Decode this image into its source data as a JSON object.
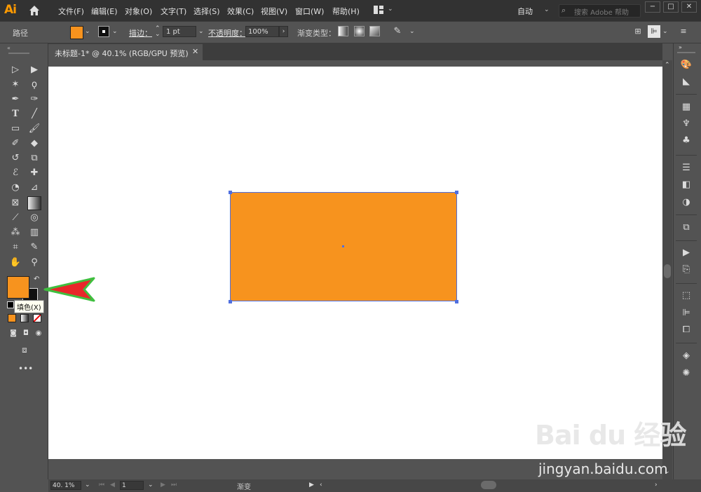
{
  "app": {
    "logo": "Ai"
  },
  "menu": [
    "文件(F)",
    "编辑(E)",
    "对象(O)",
    "文字(T)",
    "选择(S)",
    "效果(C)",
    "视图(V)",
    "窗口(W)",
    "帮助(H)"
  ],
  "workspace": "自动",
  "search": {
    "placeholder": "搜索 Adobe 帮助"
  },
  "window_buttons": [
    "−",
    "□",
    "✕"
  ],
  "control_bar": {
    "selection_type": "路径",
    "stroke_label": "描边：",
    "stroke_weight": "1 pt",
    "opacity_label": "不透明度：",
    "opacity_value": "100%",
    "gradient_type_label": "渐变类型："
  },
  "document_tab": {
    "title": "未标题-1* @ 40.1% (RGB/GPU 预览)",
    "close": "✕"
  },
  "colors": {
    "fill": "#f7931e",
    "stroke": "#000000",
    "selection": "#4f6fe0",
    "annotation_arrow": "#e8262a",
    "annotation_outline": "#3fbf3f"
  },
  "tooltip": "填色(X)",
  "status_bar": {
    "zoom": "40. 1%",
    "page": "1",
    "status_text": "渐变"
  },
  "watermark": {
    "logo": "Bai du 经验",
    "url": "jingyan.baidu.com"
  },
  "icons": {
    "tools": [
      "selection-icon",
      "direct-selection-icon",
      "magic-wand-icon",
      "lasso-icon",
      "pen-icon",
      "curvature-icon",
      "type-icon",
      "line-icon",
      "rectangle-icon",
      "paintbrush-icon",
      "shaper-icon",
      "eraser-icon",
      "rotate-icon",
      "scale-icon",
      "warp-icon",
      "puppet-warp-icon",
      "shape-builder-icon",
      "perspective-icon",
      "mesh-icon",
      "gradient-icon",
      "eyedropper-icon",
      "blend-icon",
      "symbol-sprayer-icon",
      "graph-icon",
      "artboard-icon",
      "slice-icon",
      "hand-icon",
      "zoom-icon"
    ],
    "dock": [
      "color-icon",
      "color-guide-icon",
      "swatches-icon",
      "brushes-icon",
      "symbols-icon",
      "stroke-icon",
      "gradient-panel-icon",
      "transparency-icon",
      "appearance-icon",
      "actions-icon",
      "links-icon",
      "transform-icon",
      "align-icon",
      "pathfinder-icon",
      "layers-icon",
      "asset-export-icon"
    ]
  }
}
